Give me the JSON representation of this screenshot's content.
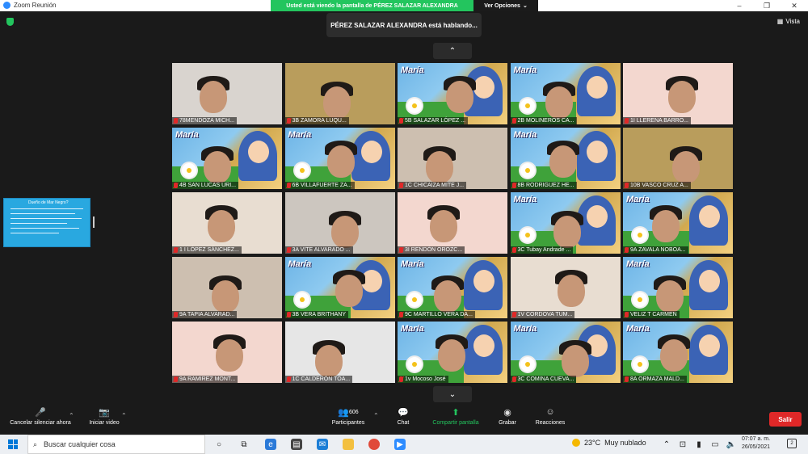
{
  "titlebar": {
    "title": "Zoom Reunión",
    "minimize": "–",
    "maximize": "❐",
    "close": "✕"
  },
  "share_banner": {
    "text": "Usted está viendo la pantalla de PÉREZ SALAZAR ALEXANDRA",
    "view_options": "Ver Opciones",
    "caret": "⌄"
  },
  "vista": {
    "label": "Vista"
  },
  "speaker": {
    "text": "PÉREZ SALAZAR ALEXANDRA está hablando..."
  },
  "pager": {
    "up": "⌃",
    "down": "⌄"
  },
  "shared_thumb": {
    "title": "Dueño de Mar Negro?"
  },
  "tiles": [
    {
      "name": "78MENDOZA MICH...",
      "kind": "room"
    },
    {
      "name": "3B ZAMORA LUQU...",
      "kind": "room"
    },
    {
      "name": "5B SALAZAR LÓPEZ ...",
      "kind": "poster"
    },
    {
      "name": "2B MOLINEROS CA...",
      "kind": "poster"
    },
    {
      "name": "1I LLERENA BARRO...",
      "kind": "room"
    },
    {
      "name": "4B SAN LUCAS URI...",
      "kind": "poster"
    },
    {
      "name": "6B VILLAFUERTE ZA...",
      "kind": "poster"
    },
    {
      "name": "1C CHICAIZA MITE J...",
      "kind": "room"
    },
    {
      "name": "8B RODRIGUEZ HE...",
      "kind": "poster"
    },
    {
      "name": "10B VASCO CRUZ A...",
      "kind": "room"
    },
    {
      "name": "1 I LÓPEZ SÁNCHEZ...",
      "kind": "room"
    },
    {
      "name": "3A VITE ALVARADO ...",
      "kind": "room"
    },
    {
      "name": "3I RENDÓN OROZC...",
      "kind": "room"
    },
    {
      "name": "3C Tubay Andrade ...",
      "kind": "poster"
    },
    {
      "name": "9A ZAVALA NOBOA...",
      "kind": "poster"
    },
    {
      "name": "9A TAPIA ALVARAD...",
      "kind": "room"
    },
    {
      "name": "3B VERA BRITHANY",
      "kind": "poster"
    },
    {
      "name": "9C MARTILLO VERA DA...",
      "kind": "poster"
    },
    {
      "name": "1V CORDOVA TUM...",
      "kind": "room"
    },
    {
      "name": "VELIZ T CARMEN",
      "kind": "poster"
    },
    {
      "name": "9A RAMIREZ MONT...",
      "kind": "room"
    },
    {
      "name": "1C CALDERÓN TOA...",
      "kind": "room"
    },
    {
      "name": "1v Mocoso José",
      "kind": "poster"
    },
    {
      "name": "3C COMINA CUEVA...",
      "kind": "poster"
    },
    {
      "name": "8A ORMAZA MALD...",
      "kind": "poster"
    }
  ],
  "poster_title": "María",
  "toolbar": {
    "mute": "Cancelar silenciar ahora",
    "video": "Iniciar video",
    "participants": "Participantes",
    "participants_count": "606",
    "chat": "Chat",
    "share": "Compartir pantalla",
    "record": "Grabar",
    "reactions": "Reacciones",
    "leave": "Salir"
  },
  "taskbar": {
    "search_placeholder": "Buscar cualquier cosa",
    "temperature": "23°C",
    "weather": "Muy nublado",
    "time": "07:07 a. m.",
    "date": "26/05/2021",
    "notif_count": "2"
  },
  "colors": {
    "accent_green": "#23c55e",
    "zoom_blue": "#2d8cff",
    "leave_red": "#e02828"
  }
}
